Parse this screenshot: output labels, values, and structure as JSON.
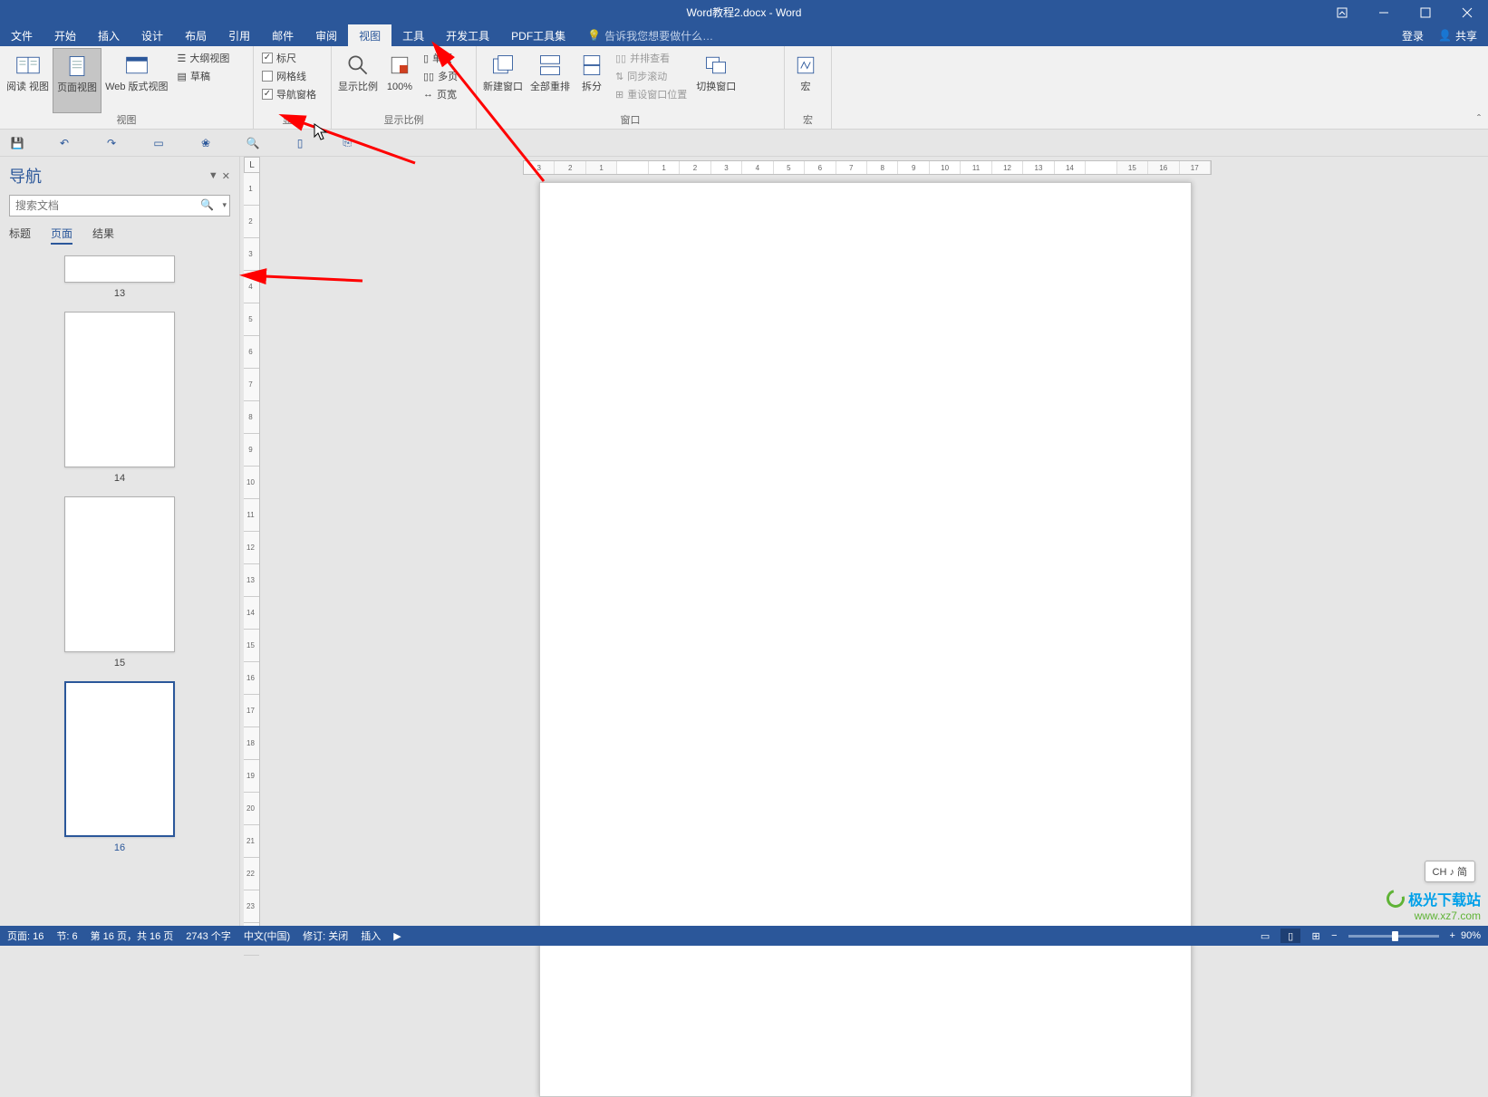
{
  "title_bar": {
    "title": "Word教程2.docx - Word"
  },
  "tabs": {
    "file": "文件",
    "home": "开始",
    "insert": "插入",
    "design": "设计",
    "layout": "布局",
    "references": "引用",
    "mailings": "邮件",
    "review": "审阅",
    "view": "视图",
    "tools": "工具",
    "developer": "开发工具",
    "pdf": "PDF工具集",
    "tell_me": "告诉我您想要做什么…",
    "login": "登录",
    "share": "共享"
  },
  "ribbon": {
    "views_group": "视图",
    "read_view": "阅读\n视图",
    "page_view": "页面视图",
    "web_view": "Web 版式视图",
    "outline": "大纲视图",
    "draft": "草稿",
    "show_group": "显示",
    "ruler": "标尺",
    "gridlines": "网格线",
    "nav_pane": "导航窗格",
    "zoom_group": "显示比例",
    "zoom": "显示比例",
    "hundred": "100%",
    "one_page": "单页",
    "multi_page": "多页",
    "page_width": "页宽",
    "window_group": "窗口",
    "new_window": "新建窗口",
    "arrange_all": "全部重排",
    "split": "拆分",
    "side_by_side": "并排查看",
    "sync_scroll": "同步滚动",
    "reset_pos": "重设窗口位置",
    "switch_window": "切换窗口",
    "macros_group": "宏",
    "macros": "宏"
  },
  "nav": {
    "title": "导航",
    "search_placeholder": "搜索文档",
    "tab_headings": "标题",
    "tab_pages": "页面",
    "tab_results": "结果",
    "thumbs": [
      {
        "num": "13",
        "cls": "t13"
      },
      {
        "num": "14",
        "cls": "tfull"
      },
      {
        "num": "15",
        "cls": "tfull"
      },
      {
        "num": "16",
        "cls": "tfull",
        "selected": true
      }
    ]
  },
  "ruler_corner": "L",
  "ime": "CH ♪ 简",
  "status": {
    "page": "页面: 16",
    "section": "节: 6",
    "page_of": "第 16 页，共 16 页",
    "words": "2743 个字",
    "lang": "中文(中国)",
    "track": "修订: 关闭",
    "insert": "插入"
  },
  "zoom_pct": "90%",
  "watermark": {
    "line1": "极光下载站",
    "line2": "www.xz7.com"
  }
}
